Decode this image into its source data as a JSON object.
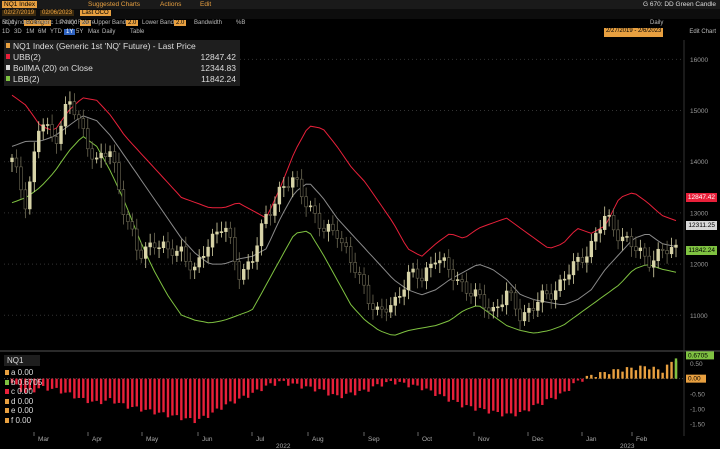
{
  "menubar": {
    "ticker": "NQ1 Index",
    "suggested": "Suggested Charts",
    "actions": "Actions",
    "edit": "Edit",
    "right_title": "G 670: DD Green Candle"
  },
  "params": {
    "start": "02/27/2019",
    "end": "02/06/2023",
    "last_price": "Last OCO",
    "study": "Study",
    "bollinger": "Bollinger",
    "period_label": "Period",
    "period": "20",
    "upper_label": "Upper Band",
    "upper": "2.0",
    "lower_label": "Lower Band",
    "lower": "2.0",
    "bandwidth": "Bandwidth",
    "bill": "%B"
  },
  "tickerbar": {
    "text": "NQ1 Index  Generic 1st 'NQ' Future"
  },
  "datebar": {
    "ranges": [
      "1D",
      "3D",
      "1M",
      "6M",
      "YTD",
      "1Y",
      "5Y",
      "Max"
    ],
    "selected": "1Y",
    "freq": "Daily",
    "table": "Table",
    "daily_label": "Daily",
    "date_range": "2/27/2019 - 2/6/2023",
    "edit_chart": "Edit Chart"
  },
  "legend": {
    "title": "NQ1 Index (Generic 1st 'NQ' Future) - Last Price",
    "rows": [
      {
        "name": "UBB(2)",
        "value": "12847.42",
        "color": "#e8203a"
      },
      {
        "name": "BollMA (20)  on Close",
        "value": "12344.83",
        "color": "#d8d8d8"
      },
      {
        "name": "LBB(2)",
        "value": "11842.24",
        "color": "#7fc241"
      }
    ]
  },
  "legend2": {
    "title": "NQ1",
    "rows": [
      {
        "name": "a 0.00",
        "color": "#e8a040"
      },
      {
        "name": "b 0.6705",
        "color": "#7fc241"
      },
      {
        "name": "c 0.00",
        "color": "#e8203a"
      },
      {
        "name": "d 0.00",
        "color": "#e8a040"
      },
      {
        "name": "e 0.00",
        "color": "#e8a040"
      },
      {
        "name": "f 0.00",
        "color": "#e8a040"
      }
    ]
  },
  "price_axis": [
    "16000",
    "15000",
    "14000",
    "13000",
    "12000",
    "11000"
  ],
  "price_tags": {
    "upper": "12847.42",
    "mid": "12311.25",
    "lower": "11842.24"
  },
  "osc_axis": [
    "0.50",
    "0.6705",
    "0.00",
    "-0.50",
    "-1.00",
    "-1.50"
  ],
  "months": [
    "Mar",
    "Apr",
    "May",
    "Jun",
    "Jul",
    "Aug",
    "Sep",
    "Oct",
    "Nov",
    "Dec",
    "Jan",
    "Feb"
  ],
  "years": [
    "2022",
    "2023"
  ],
  "colors": {
    "upper": "#e8203a",
    "mid": "#8a8a8a",
    "lower": "#7fc241",
    "candle_up": "#d8d4a8",
    "candle_down": "#6e6a55",
    "osc_neg": "#e8203a",
    "osc_pos": "#e8a040",
    "accent": "#e8a040"
  },
  "chart_data": {
    "type": "candlestick",
    "ylim": [
      10400,
      16300
    ],
    "osc_ylim": [
      -1.7,
      0.75
    ],
    "series": [
      {
        "name": "UBB(2)",
        "values": [
          15300,
          15100,
          14700,
          14600,
          15000,
          15250,
          15200,
          14900,
          14500,
          14200,
          13900,
          13600,
          13300,
          13200,
          13100,
          13100,
          13200,
          13050,
          12900,
          13500,
          14200,
          14700,
          14650,
          14300,
          13900,
          13600,
          13200,
          12800,
          12300,
          12150,
          12400,
          12600,
          12500,
          12700,
          12800,
          12900,
          12700,
          12500,
          12300,
          12400,
          12700,
          12600,
          12750,
          13300,
          13400,
          13200,
          12950,
          12850
        ]
      },
      {
        "name": "BollMA (20) on Close",
        "values": [
          14300,
          14400,
          14400,
          14500,
          14700,
          14900,
          14800,
          14500,
          14100,
          13700,
          13300,
          12900,
          12500,
          12200,
          12000,
          12000,
          12100,
          12150,
          12300,
          12900,
          13400,
          13600,
          13300,
          12900,
          12600,
          12300,
          12000,
          11700,
          11500,
          11400,
          11500,
          11700,
          11850,
          12000,
          11900,
          11700,
          11400,
          11300,
          11250,
          11200,
          11300,
          11500,
          11900,
          12200,
          12500,
          12600,
          12400,
          12344
        ]
      },
      {
        "name": "LBB(2)",
        "values": [
          13200,
          13300,
          13500,
          13800,
          14200,
          14500,
          14300,
          13800,
          13200,
          12500,
          11900,
          11400,
          11000,
          10900,
          10850,
          10900,
          11000,
          11100,
          11600,
          12100,
          12600,
          12650,
          12200,
          11700,
          11200,
          10900,
          10700,
          10600,
          10700,
          10750,
          10800,
          10900,
          11100,
          11200,
          11000,
          10800,
          10700,
          10650,
          10700,
          10800,
          11000,
          11200,
          11400,
          11600,
          11900,
          12000,
          11900,
          11842
        ]
      },
      {
        "name": "Last Price",
        "values": [
          14000,
          13200,
          14800,
          14400,
          15200,
          14600,
          14000,
          14200,
          13000,
          12100,
          12500,
          12200,
          12300,
          11800,
          12500,
          12800,
          11800,
          12100,
          12900,
          13500,
          13600,
          13200,
          12600,
          12700,
          12000,
          11500,
          11000,
          11200,
          11800,
          11700,
          12200,
          11800,
          11600,
          11300,
          11100,
          11400,
          11000,
          11200,
          11400,
          11700,
          12000,
          12400,
          12900,
          12600,
          12300,
          12100,
          12200,
          12311
        ]
      },
      {
        "name": "%B",
        "values": [
          -0.15,
          -0.5,
          -0.3,
          -0.35,
          -0.5,
          -0.7,
          -0.8,
          -0.7,
          -0.9,
          -1.0,
          -1.1,
          -1.2,
          -1.3,
          -1.4,
          -1.2,
          -0.9,
          -0.7,
          -0.5,
          -0.25,
          -0.1,
          -0.2,
          -0.3,
          -0.4,
          -0.6,
          -0.5,
          -0.4,
          -0.2,
          -0.1,
          -0.2,
          -0.3,
          -0.5,
          -0.7,
          -0.9,
          -1.0,
          -1.1,
          -1.2,
          -1.15,
          -0.9,
          -0.7,
          -0.5,
          -0.1,
          0.1,
          0.2,
          0.3,
          0.35,
          0.4,
          0.25,
          0.6705
        ]
      }
    ]
  }
}
